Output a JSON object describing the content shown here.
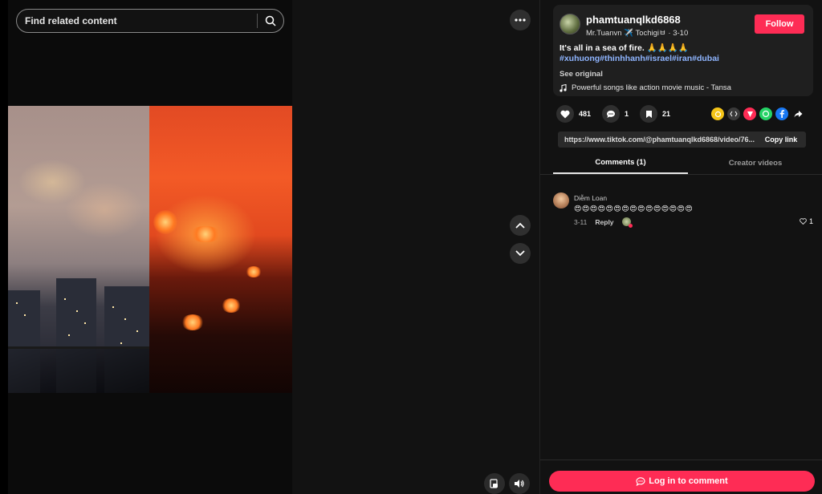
{
  "search": {
    "placeholder": "Find related content"
  },
  "post": {
    "username": "phamtuanqlkd6868",
    "display_name": "Mr.Tuanvn ✈️ Tochigiㅂ",
    "date": "3-10",
    "follow_label": "Follow",
    "caption_text": "It's all in a sea of fire. 🙏🙏🙏🙏",
    "hashtags": [
      "#xuhuong",
      "#thinhhanh",
      "#israel",
      "#iran",
      "#dubai"
    ],
    "see_original": "See original",
    "music": "Powerful songs like action movie music - Tansa"
  },
  "stats": {
    "likes": "481",
    "comments": "1",
    "saves": "21"
  },
  "share": {
    "url": "https://www.tiktok.com/@phamtuanqlkd6868/video/76...",
    "copy_label": "Copy link"
  },
  "tabs": [
    {
      "label": "Comments (1)"
    },
    {
      "label": "Creator videos"
    }
  ],
  "comments": [
    {
      "author": "Diễm Loan",
      "text": "😍😍😍😍😍😍😍😍😍😍😍😍😍😍😍",
      "date": "3-11",
      "reply_label": "Reply",
      "likes": "1"
    }
  ],
  "login_label": "Log in to comment",
  "colors": {
    "accent": "#fe2c55",
    "hashtag": "#8fb5ff"
  }
}
